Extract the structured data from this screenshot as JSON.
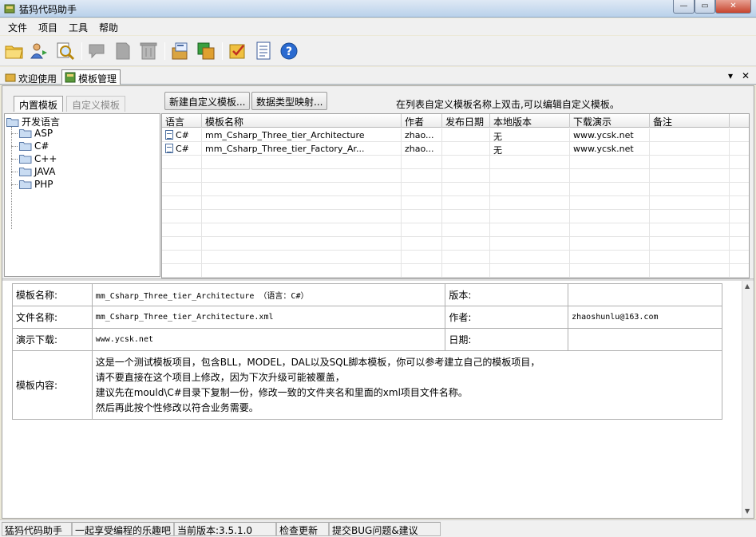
{
  "window": {
    "title": "猛犸代码助手"
  },
  "menu": [
    "文件",
    "项目",
    "工具",
    "帮助"
  ],
  "toolbar": {
    "icons": [
      "open-folder-icon",
      "users-icon",
      "search-icon",
      "comment-icon",
      "page-icon",
      "trash-icon",
      "package-icon",
      "config-icon",
      "edit-icon",
      "document-icon",
      "help-icon"
    ]
  },
  "doc_tabs": [
    {
      "label": "欢迎使用",
      "active": false
    },
    {
      "label": "模板管理",
      "active": true
    }
  ],
  "sub_tabs": [
    {
      "label": "内置模板",
      "active": true
    },
    {
      "label": "自定义模板",
      "active": false
    }
  ],
  "tree": {
    "root": "开发语言",
    "children": [
      "ASP",
      "C#",
      "C++",
      "JAVA",
      "PHP"
    ]
  },
  "actions": {
    "new_template": "新建自定义模板...",
    "type_mapping": "数据类型映射..."
  },
  "hint": "在列表自定义模板名称上双击,可以编辑自定义模板。",
  "grid": {
    "columns": [
      "语言",
      "模板名称",
      "作者",
      "发布日期",
      "本地版本",
      "下载演示",
      "备注"
    ],
    "rows": [
      [
        "C#",
        "mm_Csharp_Three_tier_Architecture",
        "zhao...",
        "",
        "无",
        "www.ycsk.net",
        ""
      ],
      [
        "C#",
        "mm_Csharp_Three_tier_Factory_Ar...",
        "zhao...",
        "",
        "无",
        "www.ycsk.net",
        ""
      ]
    ]
  },
  "details": {
    "name_label": "模板名称:",
    "name_value": "mm_Csharp_Three_tier_Architecture （语言：C#）",
    "version_label": "版本:",
    "version_value": "",
    "file_label": "文件名称:",
    "file_value": "mm_Csharp_Three_tier_Architecture.xml",
    "author_label": "作者:",
    "author_value": "zhaoshunlu@163.com",
    "demo_label": "演示下载:",
    "demo_value": "www.ycsk.net",
    "date_label": "日期:",
    "date_value": "",
    "content_label": "模板内容:",
    "content_lines": [
      "这是一个测试模板项目，包含BLL，MODEL，DAL以及SQL脚本模板，你可以参考建立自己的模板项目，",
      "请不要直接在这个项目上修改，因为下次升级可能被覆盖，",
      "建议先在mould\\C#目录下复制一份，修改一致的文件夹名和里面的xml项目文件名称。",
      "然后再此按个性修改以符合业务需要。"
    ]
  },
  "status": [
    "猛犸代码助手",
    "一起享受编程的乐趣吧",
    "当前版本:3.5.1.0",
    "检查更新",
    "提交BUG问题&建议"
  ]
}
